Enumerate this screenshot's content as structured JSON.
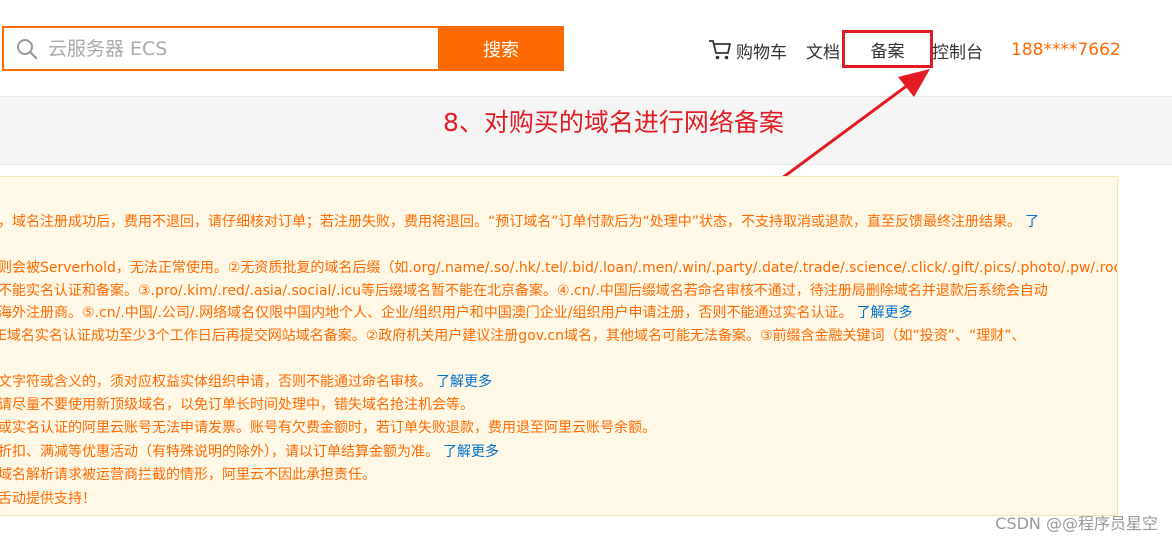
{
  "header": {
    "search": {
      "placeholder": "云服务器 ECS",
      "button_label": "搜索",
      "icon": "search-icon"
    },
    "nav": {
      "cart_label": "购物车",
      "cart_icon": "cart-icon",
      "docs_label": "文档",
      "beian_label": "备案",
      "console_label": "控制台",
      "phone": "188****7662"
    }
  },
  "annotation": {
    "text": "8、对购买的域名进行网络备案",
    "color": "#e31b23"
  },
  "notice": {
    "lines": [
      {
        "text": "，域名注册成功后，费用不退回，请仔细核对订单；若注册失败，费用将退回。“预订域名”订单付款后为“处理中”状态，不支持取消或退款，直至反馈最终注册结果。",
        "link": "了"
      },
      {
        "text": "则会被Serverhold，无法正常使用。②无资质批复的域名后缀（如.org/.name/.so/.hk/.tel/.bid/.loan/.men/.win/.party/.date/.trade/.science/.click/.gift/.pics/.photo/.pw/.rock",
        "link": ""
      },
      {
        "text": "不能实名认证和备案。③.pro/.kim/.red/.asia/.social/.icu等后缀域名暂不能在北京备案。④.cn/.中国后缀域名若命名审核不通过，待注册局删除域名并退款后系统会自动",
        "link": ""
      },
      {
        "text": "海外注册商。⑤.cn/.中国/.公司/.网络域名仅限中国内地个人、企业/组织用户和中国澳门企业/组织用户申请注册，否则不能通过实名认证。",
        "link": "了解更多"
      },
      {
        "text": "E域名实名认证成功至少3个工作日后再提交网站域名备案。②政府机关用户建议注册gov.cn域名，其他域名可能无法备案。③前缀含金融关键词（如“投资”、“理财”、",
        "link": ""
      },
      {
        "text": "文字符或含义的，须对应权益实体组织申请，否则不能通过命名审核。",
        "link": "了解更多"
      },
      {
        "text": "请尽量不要使用新顶级域名，以免订单长时间处理中，错失域名抢注机会等。",
        "link": ""
      },
      {
        "text": "或实名认证的阿里云账号无法申请发票。账号有欠费金额时，若订单失败退款，费用退至阿里云账号余额。",
        "link": ""
      },
      {
        "text": "折扣、满减等优惠活动（有特殊说明的除外），请以订单结算金额为准。",
        "link": "了解更多"
      },
      {
        "text": "域名解析请求被运营商拦截的情形，阿里云不因此承担责任。",
        "link": ""
      },
      {
        "text": "舌动提供支持！",
        "link": ""
      }
    ]
  },
  "watermark": "CSDN @@程序员星空",
  "colors": {
    "accent": "#ff6a00",
    "highlight": "#e31b23",
    "link": "#0070cc",
    "notice_bg": "#fff8e6"
  }
}
